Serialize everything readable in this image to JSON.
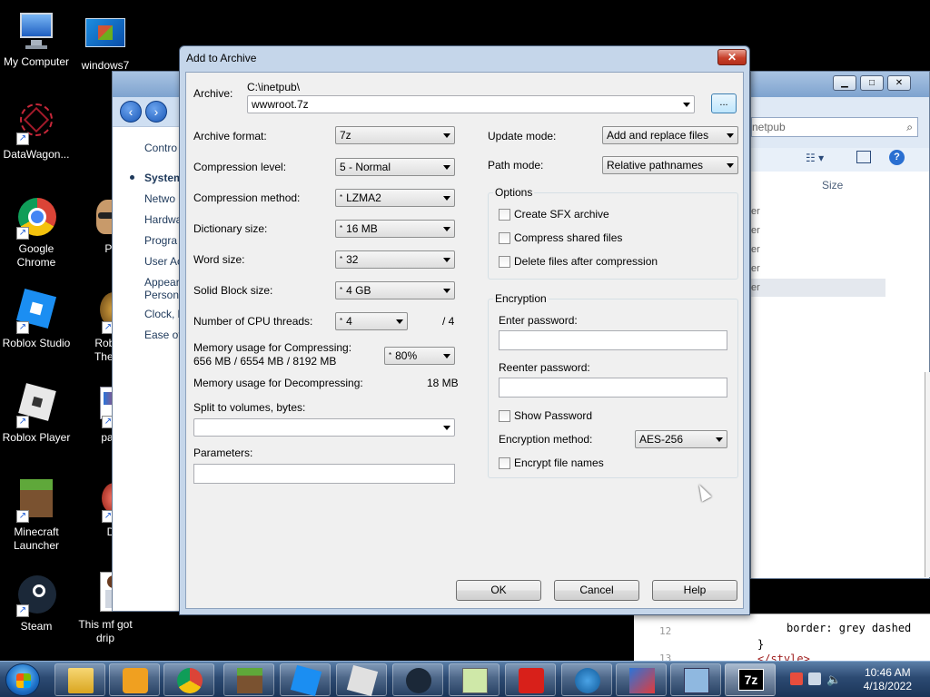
{
  "desktop": {
    "icons": [
      {
        "label": "My Computer"
      },
      {
        "label": "windows7"
      },
      {
        "label": "DataWagon..."
      },
      {
        "label": "Google Chrome"
      },
      {
        "label": "Png"
      },
      {
        "label": "Roblox Studio"
      },
      {
        "label": "Robin H The Leg"
      },
      {
        "label": "Roblox Player"
      },
      {
        "label": "paint."
      },
      {
        "label": "Minecraft Launcher"
      },
      {
        "label": "Dill"
      },
      {
        "label": "Steam"
      },
      {
        "label": "This mf got drip"
      }
    ]
  },
  "bg_window_left": {
    "items": [
      "Contro",
      "System",
      "Netwo",
      "Hardwa",
      "Progra",
      "User Ac",
      "Appear",
      "Persona",
      "Clock, l",
      "Ease of"
    ]
  },
  "bg_window_right": {
    "search": "netpub",
    "column_size": "Size",
    "rows": [
      "er",
      "er",
      "er",
      "er",
      "er"
    ]
  },
  "editor": {
    "line_numbers": [
      "12",
      "13"
    ],
    "code_lines": [
      "border: grey dashed",
      "}",
      "</style>"
    ]
  },
  "dialog": {
    "title": "Add to Archive",
    "close": "✕",
    "archive_label": "Archive:",
    "archive_path": "C:\\inetpub\\",
    "archive_name": "wwwroot.7z",
    "browse": "...",
    "format_label": "Archive format:",
    "format_value": "7z",
    "level_label": "Compression level:",
    "level_value": "5 - Normal",
    "method_label": "Compression method:",
    "method_value": "LZMA2",
    "dict_label": "Dictionary size:",
    "dict_value": "16 MB",
    "word_label": "Word size:",
    "word_value": "32",
    "solid_label": "Solid Block size:",
    "solid_value": "4 GB",
    "threads_label": "Number of CPU threads:",
    "threads_value": "4",
    "threads_max": "/ 4",
    "mem_comp_label": "Memory usage for Compressing:",
    "mem_comp_value": "656 MB / 6554 MB / 8192 MB",
    "mem_comp_pct": "80%",
    "mem_decomp_label": "Memory usage for Decompressing:",
    "mem_decomp_value": "18 MB",
    "split_label": "Split to volumes, bytes:",
    "split_value": "",
    "params_label": "Parameters:",
    "params_value": "",
    "update_label": "Update mode:",
    "update_value": "Add and replace files",
    "path_label": "Path mode:",
    "path_value": "Relative pathnames",
    "options_title": "Options",
    "opt_sfx": "Create SFX archive",
    "opt_shared": "Compress shared files",
    "opt_delete": "Delete files after compression",
    "enc_title": "Encryption",
    "enter_pw_label": "Enter password:",
    "reenter_pw_label": "Reenter password:",
    "show_pw": "Show Password",
    "enc_method_label": "Encryption method:",
    "enc_method_value": "AES-256",
    "enc_names": "Encrypt file names",
    "ok": "OK",
    "cancel": "Cancel",
    "help": "Help"
  },
  "taskbar": {
    "time": "10:46 AM",
    "date": "4/18/2022",
    "active_app_label": "7z"
  }
}
